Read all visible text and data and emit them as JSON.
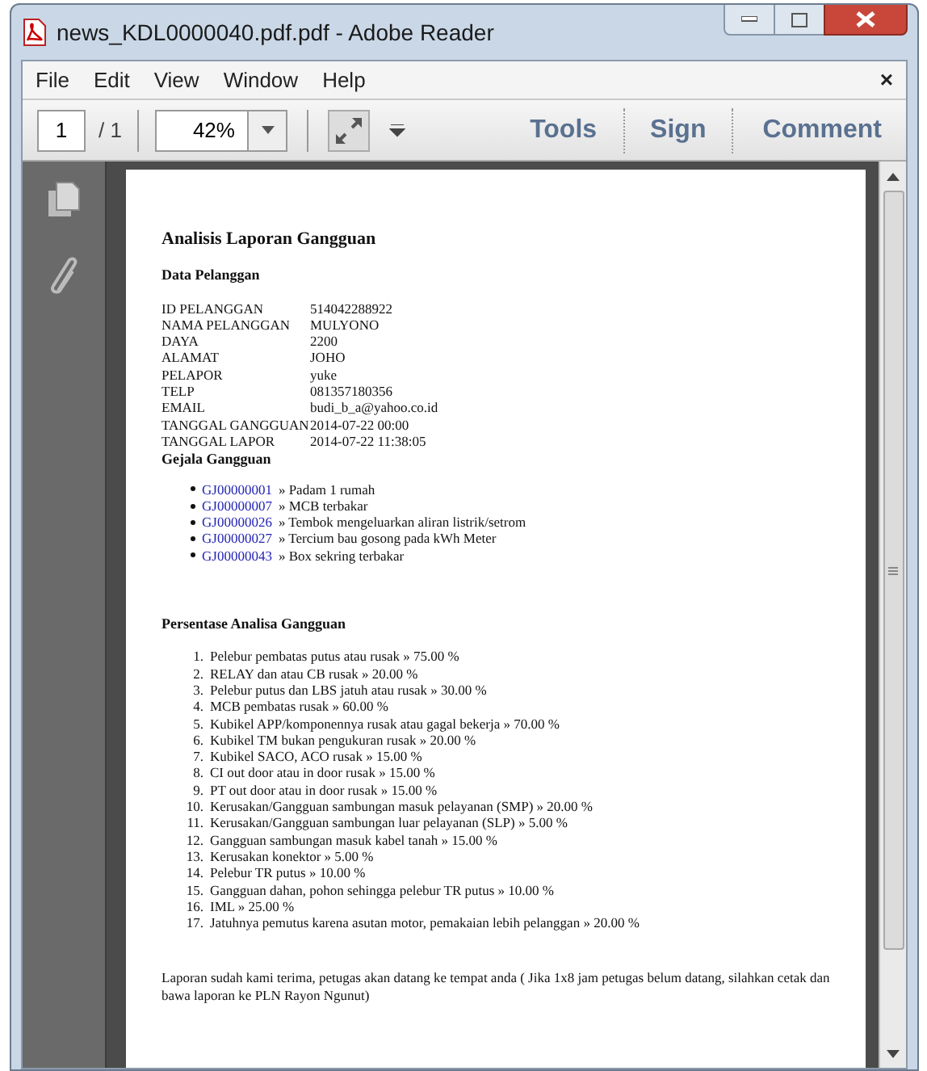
{
  "window": {
    "title": "news_KDL0000040.pdf.pdf - Adobe Reader"
  },
  "menu": [
    "File",
    "Edit",
    "View",
    "Window",
    "Help"
  ],
  "menu_close": "×",
  "toolbar": {
    "page": "1",
    "page_total": "/ 1",
    "zoom": "42%",
    "tools": "Tools",
    "sign": "Sign",
    "comment": "Comment"
  },
  "document": {
    "title": "Analisis Laporan Gangguan",
    "customer_heading": "Data Pelanggan",
    "fields": [
      {
        "label": "ID PELANGGAN",
        "value": "514042288922"
      },
      {
        "label": "NAMA PELANGGAN",
        "value": "MULYONO"
      },
      {
        "label": "DAYA",
        "value": "2200"
      },
      {
        "label": "ALAMAT",
        "value": "JOHO"
      },
      {
        "label": "PELAPOR",
        "value": "yuke"
      },
      {
        "label": "TELP",
        "value": "081357180356"
      },
      {
        "label": "EMAIL",
        "value": "budi_b_a@yahoo.co.id"
      },
      {
        "label": "TANGGAL GANGGUAN",
        "value": "2014-07-22 00:00"
      },
      {
        "label": "TANGGAL LAPOR",
        "value": "2014-07-22 11:38:05"
      }
    ],
    "symptoms_heading": "Gejala Gangguan",
    "symptoms": [
      {
        "code": "GJ00000001",
        "text": "» Padam 1 rumah"
      },
      {
        "code": "GJ00000007",
        "text": "» MCB terbakar"
      },
      {
        "code": "GJ00000026",
        "text": "» Tembok mengeluarkan aliran listrik/setrom"
      },
      {
        "code": "GJ00000027",
        "text": "» Tercium bau gosong pada kWh Meter"
      },
      {
        "code": "GJ00000043",
        "text": "» Box sekring terbakar"
      }
    ],
    "analysis_heading": "Persentase Analisa Gangguan",
    "analysis": [
      {
        "number": "1.",
        "text": "Pelebur pembatas putus atau rusak » 75.00 %"
      },
      {
        "number": "2.",
        "text": "RELAY dan atau CB rusak » 20.00 %"
      },
      {
        "number": "3.",
        "text": "Pelebur putus dan LBS jatuh atau rusak » 30.00 %"
      },
      {
        "number": "4.",
        "text": "MCB pembatas rusak » 60.00 %"
      },
      {
        "number": "5.",
        "text": "Kubikel APP/komponennya rusak atau gagal bekerja » 70.00 %"
      },
      {
        "number": "6.",
        "text": "Kubikel TM bukan pengukuran rusak » 20.00 %"
      },
      {
        "number": "7.",
        "text": "Kubikel SACO, ACO rusak » 15.00 %"
      },
      {
        "number": "8.",
        "text": "CI out door atau in door rusak » 15.00 %"
      },
      {
        "number": "9.",
        "text": "PT out door atau in door rusak » 15.00 %"
      },
      {
        "number": "10.",
        "text": "Kerusakan/Gangguan sambungan masuk pelayanan (SMP) » 20.00 %"
      },
      {
        "number": "11.",
        "text": "Kerusakan/Gangguan sambungan luar pelayanan (SLP) » 5.00 %"
      },
      {
        "number": "12.",
        "text": "Gangguan sambungan masuk kabel tanah » 15.00 %"
      },
      {
        "number": "13.",
        "text": "Kerusakan konektor » 5.00 %"
      },
      {
        "number": "14.",
        "text": "Pelebur TR putus » 10.00 %"
      },
      {
        "number": "15.",
        "text": "Gangguan dahan, pohon sehingga pelebur TR putus » 10.00 %"
      },
      {
        "number": "16.",
        "text": "IML » 25.00 %"
      },
      {
        "number": "17.",
        "text": "Jatuhnya pemutus karena asutan motor, pemakaian lebih pelanggan » 20.00 %"
      }
    ],
    "footer": "Laporan sudah kami terima, petugas akan datang ke tempat anda ( Jika 1x8 jam petugas belum datang, silahkan cetak dan bawa laporan ke PLN Rayon Ngunut)"
  }
}
